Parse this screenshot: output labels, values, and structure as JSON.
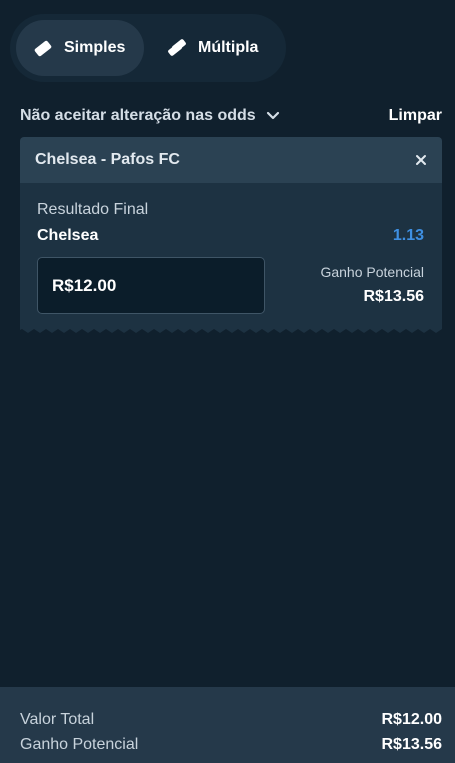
{
  "tabs": [
    {
      "label": "Simples",
      "icon": "ticket-icon",
      "active": true
    },
    {
      "label": "Múltipla",
      "icon": "tickets-icon",
      "active": false
    }
  ],
  "toolbar": {
    "odds_option": "Não aceitar alteração nas odds",
    "clear_label": "Limpar"
  },
  "bet": {
    "event": "Chelsea - Pafos FC",
    "market": "Resultado Final",
    "selection": "Chelsea",
    "odd": "1.13",
    "stake": "R$12.00",
    "potential_label": "Ganho Potencial",
    "potential_value": "R$13.56"
  },
  "summary": {
    "total_label": "Valor Total",
    "total_value": "R$12.00",
    "potential_label": "Ganho Potencial",
    "potential_value": "R$13.56"
  },
  "colors": {
    "background": "#10202d",
    "card_header": "#2b4253",
    "card_body": "#1d3242",
    "odd_accent": "#3e8fe2",
    "footer": "#25394a"
  }
}
